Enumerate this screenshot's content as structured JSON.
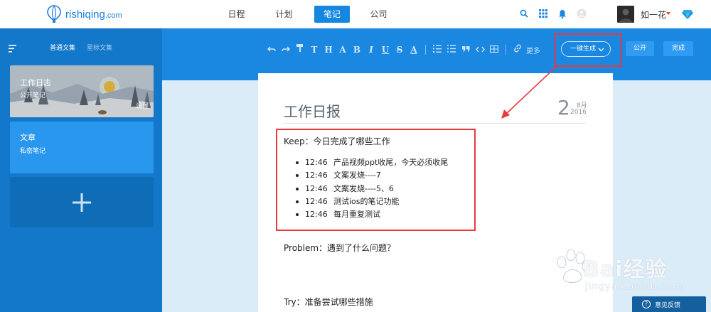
{
  "brand": {
    "name": "rishiqing",
    "domain": ".com"
  },
  "nav": {
    "items": [
      "日程",
      "计划",
      "笔记",
      "公司"
    ],
    "active": "笔记"
  },
  "user": {
    "name": "如一花"
  },
  "sidebar": {
    "tabs": [
      "普通文集",
      "星标文集"
    ],
    "notebooks": [
      {
        "title": "工作日志",
        "subtitle": "公开笔记",
        "settings": "设置"
      },
      {
        "title": "文章",
        "subtitle": "私密笔记"
      }
    ],
    "add_symbol": "+"
  },
  "toolbar": {
    "more_label": "更多",
    "generate_label": "一键生成",
    "publish_label": "公开",
    "done_label": "完成"
  },
  "document": {
    "title": "工作日报",
    "date": {
      "day": "2",
      "month": "8月",
      "year": "2016"
    },
    "keep_heading": "Keep：今日完成了哪些工作",
    "tasks": [
      {
        "time": "12:46",
        "text": "产品视频ppt收尾，今天必须收尾"
      },
      {
        "time": "12:46",
        "text": "文案发烧----7"
      },
      {
        "time": "12:46",
        "text": "文案发烧----5、6"
      },
      {
        "time": "12:46",
        "text": "测试ios的笔记功能"
      },
      {
        "time": "12:46",
        "text": "每月重复测试"
      }
    ],
    "problem_heading": "Problem：遇到了什么问题？",
    "try_heading": "Try：准备尝试哪些措施"
  },
  "watermark": {
    "text": "Bai经验",
    "url": "jingyan.baidu.com"
  },
  "feedback": {
    "label": "意见反馈"
  },
  "colors": {
    "accent": "#1a87e0",
    "sidebar": "#1378c9",
    "annotation": "#e8393f"
  }
}
